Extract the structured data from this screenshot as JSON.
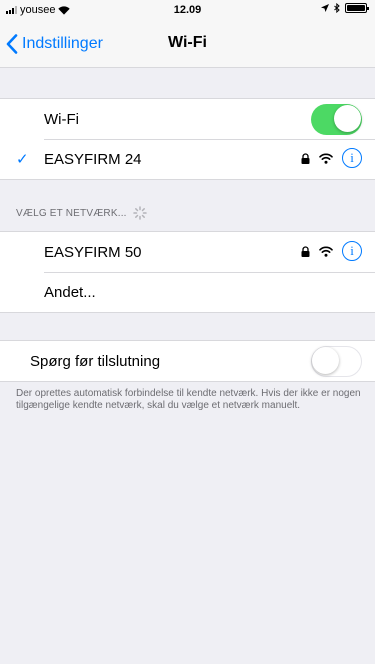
{
  "status_bar": {
    "carrier": "yousee",
    "time": "12.09",
    "icons": [
      "signal-bars-icon",
      "wifi-icon",
      "location-arrow-icon",
      "bluetooth-icon",
      "battery-icon"
    ]
  },
  "nav": {
    "back_label": "Indstillinger",
    "title": "Wi-Fi"
  },
  "wifi_group": {
    "toggle_label": "Wi-Fi",
    "toggle_state": "on",
    "connected_network": "EASYFIRM 24"
  },
  "networks": {
    "header": "VÆLG ET NETVÆRK...",
    "items": [
      {
        "name": "EASYFIRM 50"
      }
    ],
    "other_label": "Andet..."
  },
  "ask_group": {
    "label": "Spørg før tilslutning",
    "toggle_state": "off",
    "note": "Der oprettes automatisk forbindelse til kendte netværk. Hvis der ikke er nogen tilgængelige kendte netværk, skal du vælge et netværk manuelt."
  },
  "colors": {
    "accent": "#007aff",
    "toggle_on": "#4cd964",
    "background": "#efeff4"
  }
}
